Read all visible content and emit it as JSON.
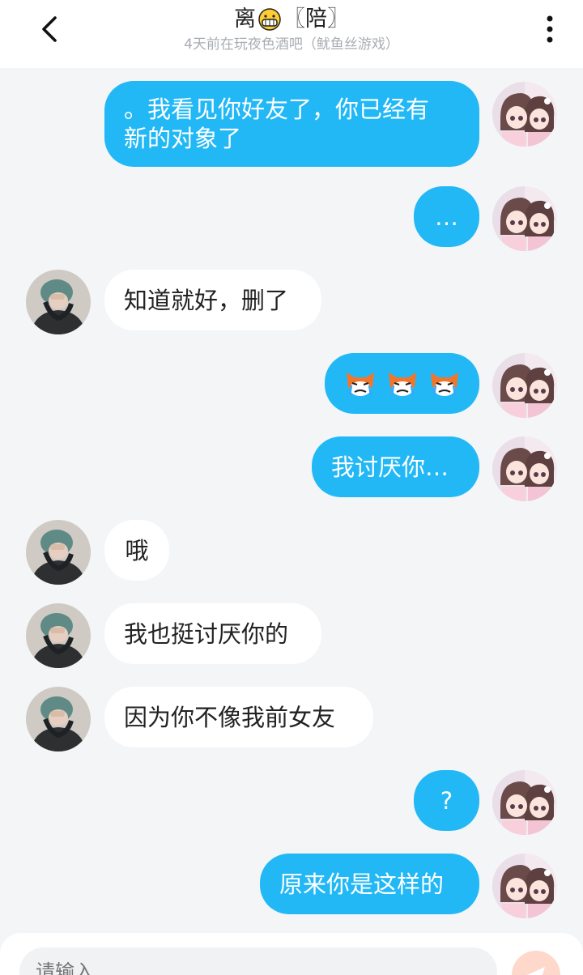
{
  "header": {
    "title_name": "离",
    "title_tag": "〖陪〗",
    "subtitle": "4天前在玩夜色酒吧（鱿鱼丝游戏）"
  },
  "messages": [
    {
      "sender": "me",
      "lines": [
        "。我看见你好友了，你已经有",
        "新的对象了"
      ]
    },
    {
      "sender": "me",
      "text": "…"
    },
    {
      "sender": "other",
      "text": "知道就好，删了"
    },
    {
      "sender": "me",
      "text": "",
      "stickers": [
        "crying-fox",
        "crying-fox",
        "crying-fox"
      ]
    },
    {
      "sender": "me",
      "text": "我讨厌你…"
    },
    {
      "sender": "other",
      "text": "哦"
    },
    {
      "sender": "other",
      "text": "我也挺讨厌你的"
    },
    {
      "sender": "other",
      "text": "因为你不像我前女友"
    },
    {
      "sender": "me",
      "text": "?"
    },
    {
      "sender": "me",
      "text": "原来你是这样的"
    }
  ],
  "composer": {
    "placeholder": "请输入..."
  },
  "colors": {
    "accent": "#22b8f6",
    "background": "#f3f5f7",
    "send": "#ffd8cc"
  }
}
